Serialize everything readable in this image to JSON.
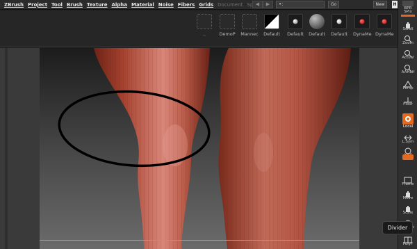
{
  "menubar": {
    "items": [
      "ZBrush",
      "Project",
      "Tool",
      "Brush",
      "Texture",
      "Alpha",
      "Material",
      "Noise",
      "Fibers",
      "Grids"
    ],
    "dim_items": [
      "Document",
      "Spotlight"
    ],
    "search_value": "•:",
    "go_label": "Go",
    "new_label": "New",
    "help_label": "H"
  },
  "shelf": {
    "slots": [
      {
        "label": "..",
        "icon": "history-icon"
      },
      {
        "label": "DemoP",
        "icon": "demo-project-icon"
      },
      {
        "label": "Mannec",
        "icon": "mannequin-icon"
      },
      {
        "label": "Default",
        "icon": "default-material-icon"
      },
      {
        "label": "Default",
        "icon": "default-sphere-icon"
      },
      {
        "label": "Default",
        "icon": "default-large-sphere-icon"
      },
      {
        "label": "Default",
        "icon": "default-small-sphere-icon"
      },
      {
        "label": "DynaMe",
        "icon": "dynamesh-icon"
      },
      {
        "label": "DynaMe",
        "icon": "dynamesh-icon"
      }
    ]
  },
  "right_panel": {
    "top_label": "BPR",
    "spix_label": "SPix",
    "tools": [
      "Scroll",
      "Zoom",
      "Actual",
      "AAHalf",
      "Persp",
      "Floor",
      "Local",
      "L.Sym",
      "XYZ",
      "Frame",
      "Move",
      "Scale",
      "Rotate",
      "PolyF"
    ],
    "active_tool": "Local"
  },
  "tooltip": {
    "text": "Divider"
  },
  "colors": {
    "accent": "#e46a22",
    "skin": "#b4503e",
    "background": "#1e1e1e"
  }
}
